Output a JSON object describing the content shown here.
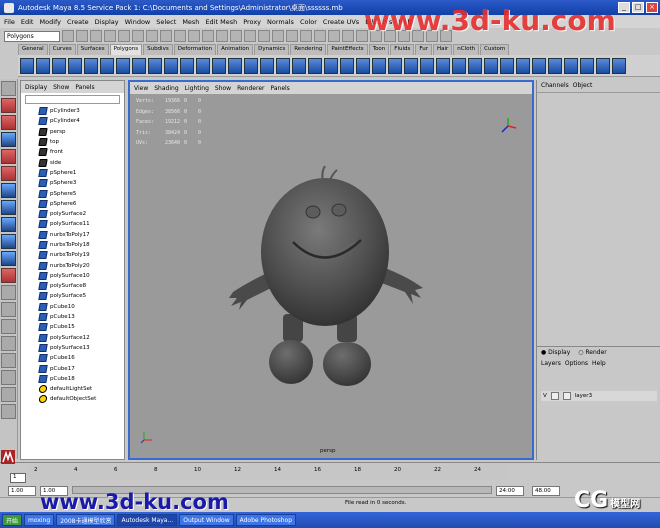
{
  "window": {
    "title": "Autodesk Maya 8.5 Service Pack 1: C:\\Documents and Settings\\Administrator\\桌面\\ssssss.mb"
  },
  "menubar": [
    "File",
    "Edit",
    "Modify",
    "Create",
    "Display",
    "Window",
    "Select",
    "Mesh",
    "Edit Mesh",
    "Proxy",
    "Normals",
    "Color",
    "Create UVs",
    "Edit UVs",
    "Help"
  ],
  "mode": "Polygons",
  "shelf_tabs": [
    "General",
    "Curves",
    "Surfaces",
    "Polygons",
    "Subdivs",
    "Deformation",
    "Animation",
    "Dynamics",
    "Rendering",
    "PaintEffects",
    "Toon",
    "Fluids",
    "Fur",
    "Hair",
    "nCloth",
    "Custom"
  ],
  "outliner": {
    "menu": [
      "Display",
      "Show",
      "Panels"
    ],
    "items": [
      {
        "label": "pCylinder3",
        "type": "mesh"
      },
      {
        "label": "pCylinder4",
        "type": "mesh"
      },
      {
        "label": "persp",
        "type": "camera"
      },
      {
        "label": "top",
        "type": "camera"
      },
      {
        "label": "front",
        "type": "camera"
      },
      {
        "label": "side",
        "type": "camera"
      },
      {
        "label": "pSphere1",
        "type": "mesh"
      },
      {
        "label": "pSphere3",
        "type": "mesh"
      },
      {
        "label": "pSphere5",
        "type": "mesh"
      },
      {
        "label": "pSphere6",
        "type": "mesh"
      },
      {
        "label": "polySurface2",
        "type": "mesh"
      },
      {
        "label": "polySurface11",
        "type": "mesh"
      },
      {
        "label": "nurbsToPoly17",
        "type": "mesh"
      },
      {
        "label": "nurbsToPoly18",
        "type": "mesh"
      },
      {
        "label": "nurbsToPoly19",
        "type": "mesh"
      },
      {
        "label": "nurbsToPoly20",
        "type": "mesh"
      },
      {
        "label": "polySurface10",
        "type": "mesh"
      },
      {
        "label": "polySurface8",
        "type": "mesh"
      },
      {
        "label": "polySurface5",
        "type": "mesh"
      },
      {
        "label": "pCube10",
        "type": "mesh"
      },
      {
        "label": "pCube13",
        "type": "mesh"
      },
      {
        "label": "pCube15",
        "type": "mesh"
      },
      {
        "label": "polySurface12",
        "type": "mesh"
      },
      {
        "label": "polySurface13",
        "type": "mesh"
      },
      {
        "label": "pCube16",
        "type": "mesh"
      },
      {
        "label": "pCube17",
        "type": "mesh"
      },
      {
        "label": "pCube18",
        "type": "mesh"
      },
      {
        "label": "defaultLightSet",
        "type": "set"
      },
      {
        "label": "defaultObjectSet",
        "type": "set"
      }
    ]
  },
  "viewport": {
    "menu": [
      "View",
      "Shading",
      "Lighting",
      "Show",
      "Renderer",
      "Panels"
    ],
    "stats": [
      {
        "label": "Verts:",
        "value": "19366",
        "sel1": "0",
        "sel2": "0"
      },
      {
        "label": "Edges:",
        "value": "38566",
        "sel1": "0",
        "sel2": "0"
      },
      {
        "label": "Faces:",
        "value": "19212",
        "sel1": "0",
        "sel2": "0"
      },
      {
        "label": "Tris:",
        "value": "38424",
        "sel1": "0",
        "sel2": "0"
      },
      {
        "label": "UVs:",
        "value": "23640",
        "sel1": "0",
        "sel2": "0"
      }
    ],
    "camera_label": "persp"
  },
  "channel_box": {
    "menu": [
      "Channels",
      "Object"
    ]
  },
  "layers": {
    "tabs": [
      "Display",
      "Render"
    ],
    "menu": [
      "Layers",
      "Options",
      "Help"
    ],
    "rows": [
      {
        "visible": "V",
        "name": "layer3"
      }
    ]
  },
  "timeline": {
    "ticks": [
      "2",
      "4",
      "6",
      "8",
      "10",
      "12",
      "14",
      "16",
      "18",
      "20",
      "22",
      "24"
    ],
    "current_frame": "1"
  },
  "range": {
    "start": "1.00",
    "inner_start": "1.00",
    "inner_end": "24:00",
    "end": "48.00"
  },
  "command_line": {
    "status": "File read in 0 seconds."
  },
  "taskbar": [
    "开始",
    "moxing",
    "2008卡通模型欣赏",
    "Autodesk Maya...",
    "Output Window",
    "Adobe Photoshop"
  ],
  "watermarks": {
    "site": "www.3d-ku.com",
    "cg_top": "CG",
    "cg_small": "模型网"
  },
  "colors": {
    "title_bar": "#1140a8",
    "viewport_bg": "#9a9a9a",
    "active_border": "#3a6ad0"
  }
}
